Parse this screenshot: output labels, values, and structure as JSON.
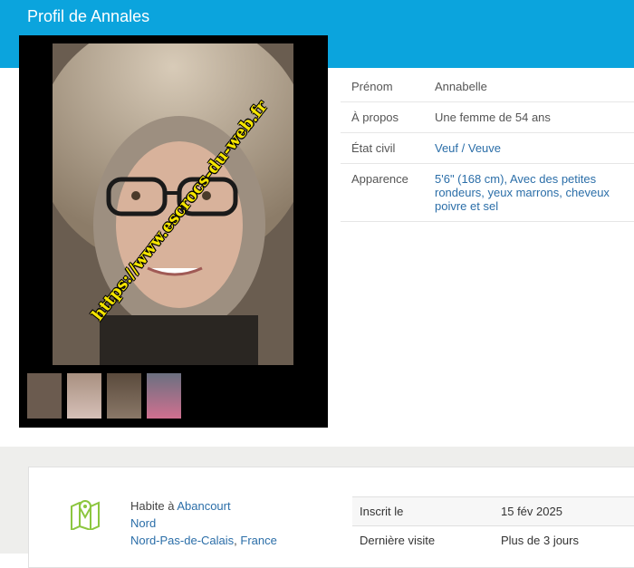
{
  "header": {
    "title": "Profil de Annales"
  },
  "photo": {
    "watermark": "https://www.escrocs-du-web.fr",
    "thumbnail_count": 4
  },
  "profile": {
    "rows": [
      {
        "label": "Prénom",
        "value": "Annabelle"
      },
      {
        "label": "À propos",
        "value": "Une femme de 54 ans"
      },
      {
        "label": "État civil",
        "value": "Veuf / Veuve"
      },
      {
        "label": "Apparence",
        "value": "5'6\" (168 cm), Avec des petites rondeurs, yeux marrons, cheveux poivre et sel"
      }
    ]
  },
  "location": {
    "lives_in_label": "Habite à",
    "city": "Abancourt",
    "department": "Nord",
    "region": "Nord-Pas-de-Calais",
    "separator": ",",
    "country": "France"
  },
  "registration": {
    "rows": [
      {
        "label": "Inscrit le",
        "value": "15 fév 2025"
      },
      {
        "label": "Dernière visite",
        "value": "Plus de 3 jours"
      }
    ]
  },
  "colors": {
    "header_bg": "#0ba4dd",
    "link": "#2b6ea8",
    "watermark": "#f5e500",
    "map_icon": "#8cc63f"
  },
  "icons": {
    "location": "map-pin-icon"
  }
}
